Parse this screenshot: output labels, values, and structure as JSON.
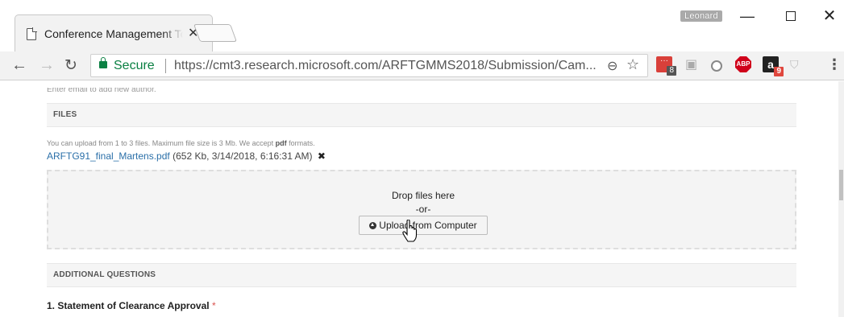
{
  "window": {
    "tab_title": "Conference Management Toolkit",
    "user": "Leonard",
    "minimize": "—",
    "close": "✕"
  },
  "toolbar": {
    "secure_label": "Secure",
    "url": "https://cmt3.research.microsoft.com/ARFTGMMS2018/Submission/Cam...",
    "extensions": [
      {
        "name": "todoist",
        "badge": "8"
      },
      {
        "name": "camera"
      },
      {
        "name": "circle"
      },
      {
        "name": "adblock",
        "label": "ABP"
      },
      {
        "name": "amazon",
        "label": "a",
        "badge": "9"
      },
      {
        "name": "pocket"
      }
    ]
  },
  "page": {
    "cutoff_text": "Enter email to add new author.",
    "files_section": {
      "heading": "FILES",
      "hint_prefix": "You can upload from 1 to 3 files. Maximum file size is 3 Mb. We accept",
      "hint_format": "pdf",
      "hint_suffix": "formats.",
      "file": {
        "name": "ARFTG91_final_Martens.pdf",
        "meta": "(652 Kb, 3/14/2018, 6:16:31 AM)"
      },
      "dropzone": {
        "drop_text": "Drop files here",
        "or_text": "-or-",
        "upload_label": "Upload from Computer"
      }
    },
    "questions_section": {
      "heading": "ADDITIONAL QUESTIONS",
      "question_1": "1. Statement of Clearance Approval",
      "required_mark": "*"
    }
  },
  "colors": {
    "secure_green": "#0b8043",
    "link_blue": "#2a6fa8",
    "required_red": "#d9534f"
  }
}
